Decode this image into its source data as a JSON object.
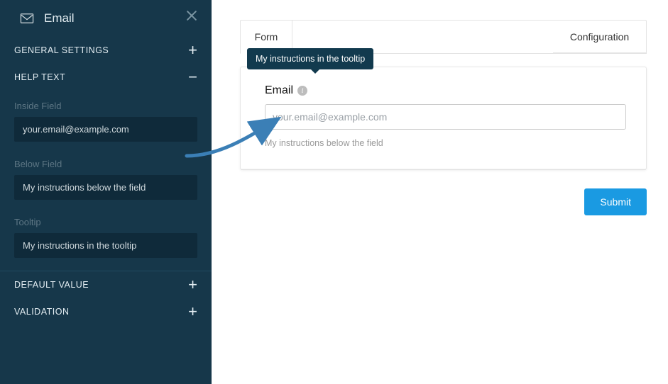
{
  "sidebar": {
    "title": "Email",
    "sections": {
      "general": {
        "title": "GENERAL SETTINGS"
      },
      "help_text": {
        "title": "HELP TEXT",
        "fields": {
          "inside": {
            "label": "Inside Field",
            "value": "your.email@example.com"
          },
          "below": {
            "label": "Below Field",
            "value": "My instructions below the field"
          },
          "tooltip": {
            "label": "Tooltip",
            "value": "My instructions in the tooltip"
          }
        }
      },
      "default_value": {
        "title": "DEFAULT VALUE"
      },
      "validation": {
        "title": "VALIDATION"
      }
    }
  },
  "main": {
    "tabs": {
      "form": "Form",
      "configuration": "Configuration"
    },
    "tooltip_text": "My instructions in the tooltip",
    "field": {
      "label": "Email",
      "placeholder": "your.email@example.com",
      "below_text": "My instructions below the field"
    },
    "submit_label": "Submit"
  }
}
